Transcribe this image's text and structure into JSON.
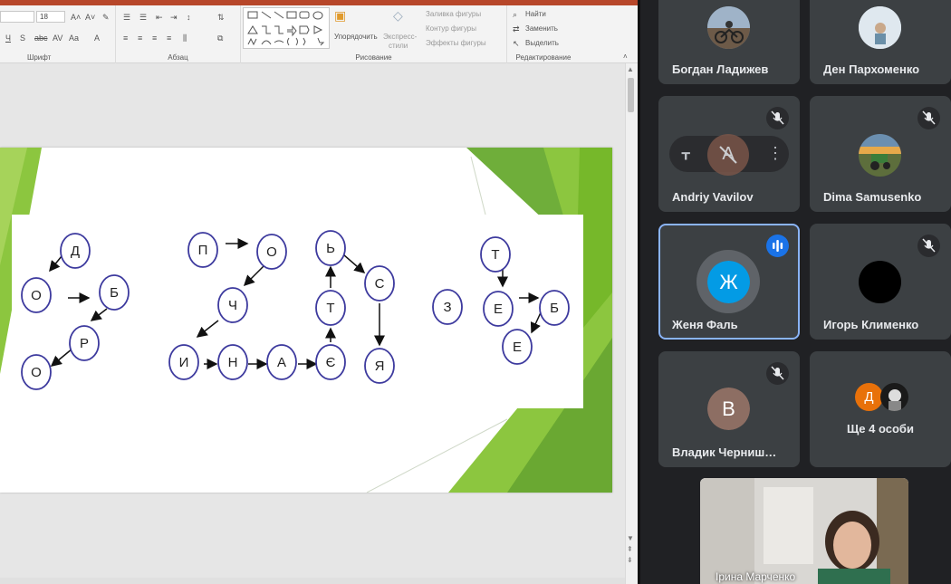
{
  "ribbon": {
    "font_size": "18",
    "groups": {
      "font": "Шрифт",
      "paragraph": "Абзац",
      "drawing": "Рисование",
      "editing": "Редактирование"
    },
    "arrange": "Упорядочить",
    "quick_styles_1": "Экспресс-",
    "quick_styles_2": "стили",
    "shape_fill": "Заливка фигуры",
    "shape_outline": "Контур фигуры",
    "shape_effects": "Эффекты фигуры",
    "find": "Найти",
    "replace": "Заменить",
    "select": "Выделить"
  },
  "slide": {
    "nodes": [
      "Д",
      "О",
      "Б",
      "Р",
      "О",
      "П",
      "О",
      "Ч",
      "И",
      "Н",
      "А",
      "Є",
      "Ь",
      "Т",
      "С",
      "Я",
      "З",
      "Т",
      "Е",
      "Б",
      "Е"
    ]
  },
  "participants": [
    {
      "name": "Богдан Ладижев",
      "avatar": "photo-motorbike",
      "mic": "on"
    },
    {
      "name": "Ден Пархоменко",
      "avatar": "photo-person-sky",
      "mic": "on"
    },
    {
      "name": "Andriy Vavilov",
      "avatar": "letter",
      "initial": "A",
      "mic": "off",
      "avatar_color": "#795548"
    },
    {
      "name": "Dima Samusenko",
      "avatar": "photo-tractor",
      "mic": "off"
    },
    {
      "name": "Женя Фаль",
      "avatar": "letter",
      "initial": "Ж",
      "mic": "speaking",
      "avatar_color": "#039be5"
    },
    {
      "name": "Игорь Клименко",
      "avatar": "black",
      "mic": "off"
    },
    {
      "name": "Владик Черниш…",
      "avatar": "letter",
      "initial": "В",
      "mic": "off",
      "avatar_color": "#8d6e63"
    },
    {
      "name": "Ще 4 особи",
      "avatar": "group",
      "initial": "Д",
      "avatar_color": "#e8710a"
    }
  ],
  "self_view": {
    "name": "Ірина Марченко"
  },
  "colors": {
    "meet_bg": "#202124",
    "tile_bg": "#3c4043",
    "active_border": "#8ab4f8",
    "slide_green": "#8cc63f",
    "node_stroke": "#3d3a9e"
  }
}
